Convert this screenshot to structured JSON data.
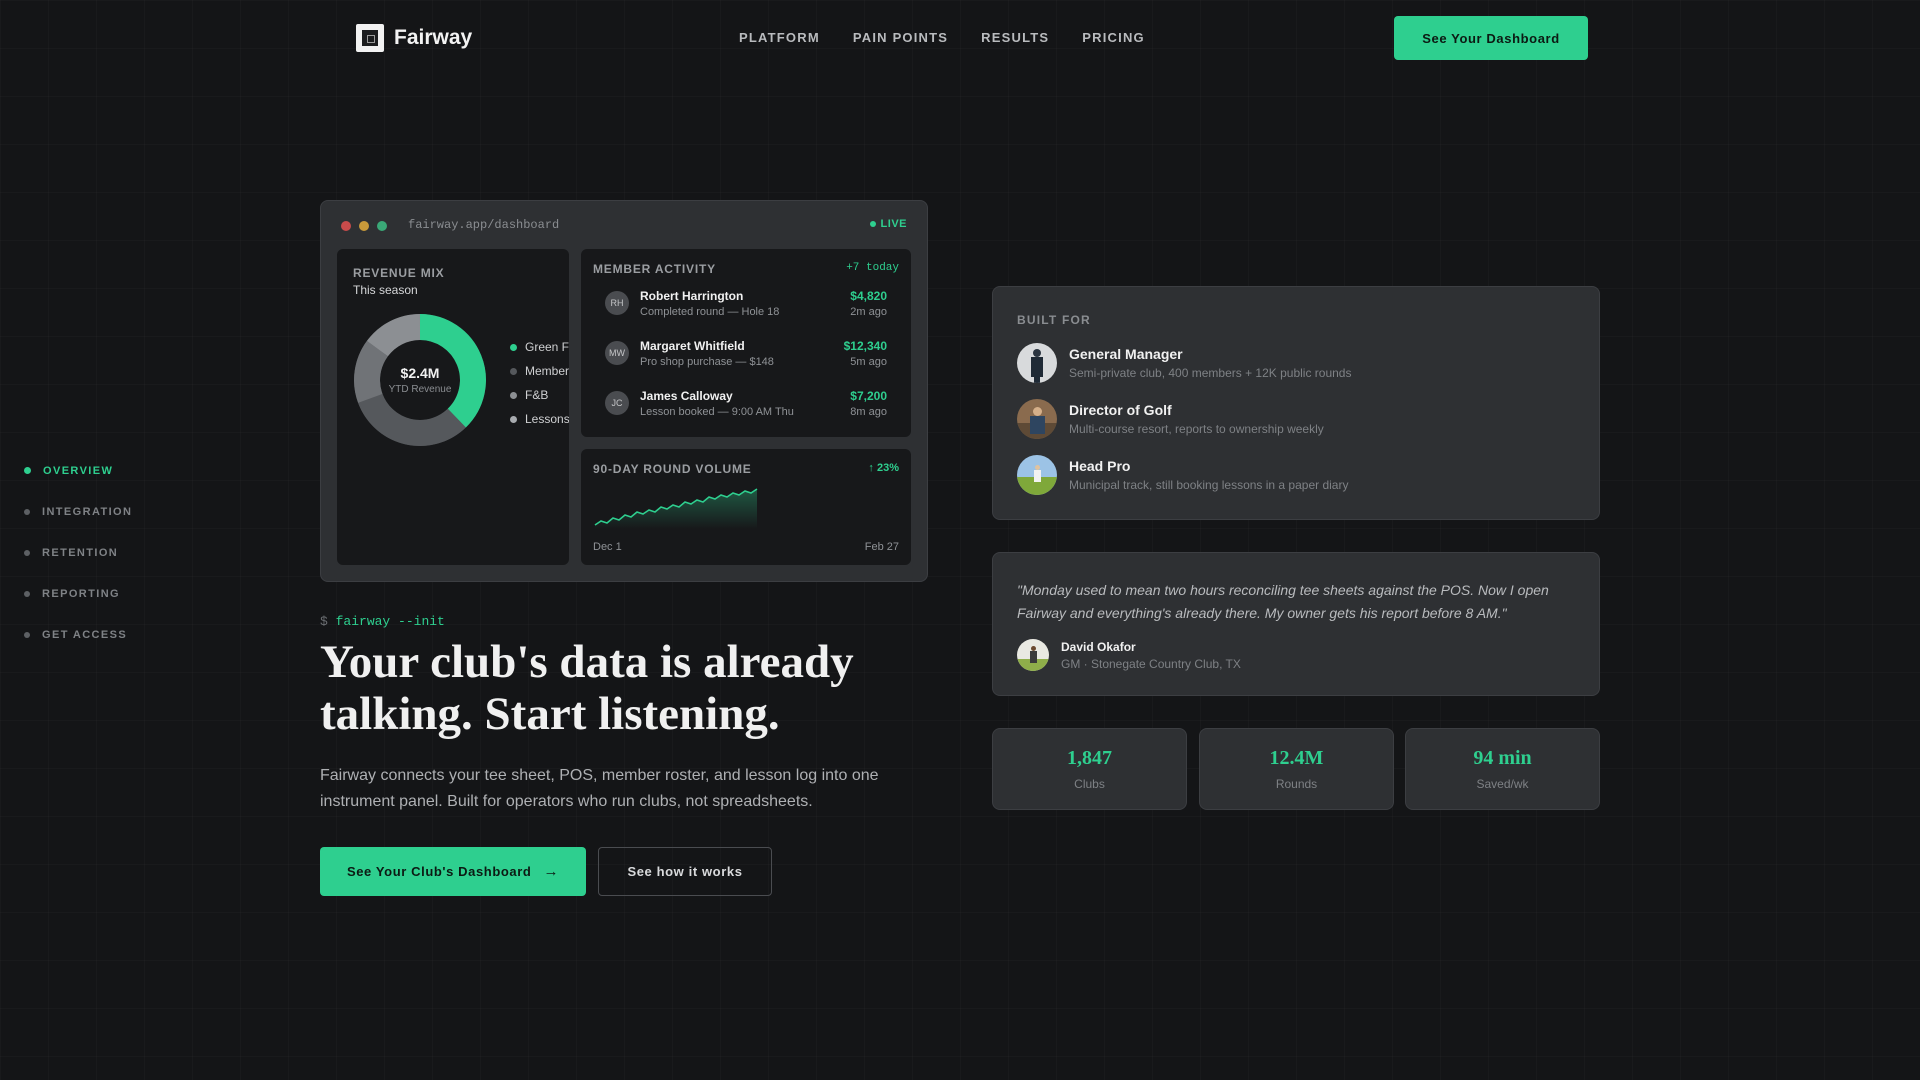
{
  "brand": {
    "name": "Fairway"
  },
  "nav": {
    "items": [
      "PLATFORM",
      "PAIN POINTS",
      "RESULTS",
      "PRICING"
    ],
    "cta": "See Your Dashboard"
  },
  "side_nav": {
    "items": [
      "OVERVIEW",
      "INTEGRATION",
      "RETENTION",
      "REPORTING",
      "GET ACCESS"
    ],
    "active": "OVERVIEW"
  },
  "dashboard": {
    "url": "fairway.app/dashboard",
    "live": "LIVE",
    "revenue": {
      "title": "REVENUE MIX",
      "subtitle": "This season",
      "center_value": "$2.4M",
      "center_label": "YTD Revenue",
      "legend": [
        "Green Fees",
        "Memberships",
        "F&B",
        "Lessons"
      ]
    },
    "members": {
      "title": "MEMBER ACTIVITY",
      "badge": "+7 today",
      "rows": [
        {
          "initials": "RH",
          "name": "Robert Harrington",
          "desc": "Completed round — Hole 18",
          "amount": "$4,820",
          "time": "2m ago"
        },
        {
          "initials": "MW",
          "name": "Margaret Whitfield",
          "desc": "Pro shop purchase — $148",
          "amount": "$12,340",
          "time": "5m ago"
        },
        {
          "initials": "JC",
          "name": "James Calloway",
          "desc": "Lesson booked — 9:00 AM Thu",
          "amount": "$7,200",
          "time": "8m ago"
        }
      ]
    },
    "volume": {
      "title": "90-DAY ROUND VOLUME",
      "badge": "↑ 23%",
      "start": "Dec 1",
      "end": "Feb 27"
    }
  },
  "hero": {
    "prompt": "$",
    "command": "fairway --init",
    "title": "Your club's data is already talking. Start listening.",
    "subtitle": "Fairway connects your tee sheet, POS, member roster, and lesson log into one instrument panel. Built for operators who run clubs, not spreadsheets.",
    "primary_cta": "See Your Club's Dashboard",
    "secondary_cta": "See how it works"
  },
  "built_for": {
    "title": "BUILT FOR",
    "personas": [
      {
        "role": "General Manager",
        "desc": "Semi-private club, 400 members + 12K public rounds"
      },
      {
        "role": "Director of Golf",
        "desc": "Multi-course resort, reports to ownership weekly"
      },
      {
        "role": "Head Pro",
        "desc": "Municipal track, still booking lessons in a paper diary"
      }
    ]
  },
  "testimonial": {
    "quote": "\"Monday used to mean two hours reconciling tee sheets against the POS. Now I open Fairway and everything's already there. My owner gets his report before 8 AM.\"",
    "name": "David Okafor",
    "role": "GM · Stonegate Country Club, TX"
  },
  "stats": [
    {
      "value": "1,847",
      "label": "Clubs"
    },
    {
      "value": "12.4M",
      "label": "Rounds"
    },
    {
      "value": "94 min",
      "label": "Saved/wk"
    }
  ],
  "colors": {
    "accent": "#2ecf8f",
    "background": "#141517",
    "card": "#2e3033",
    "dot_red": "#c94b4b",
    "dot_yellow": "#c99a3a",
    "dot_green": "#3aa877"
  }
}
